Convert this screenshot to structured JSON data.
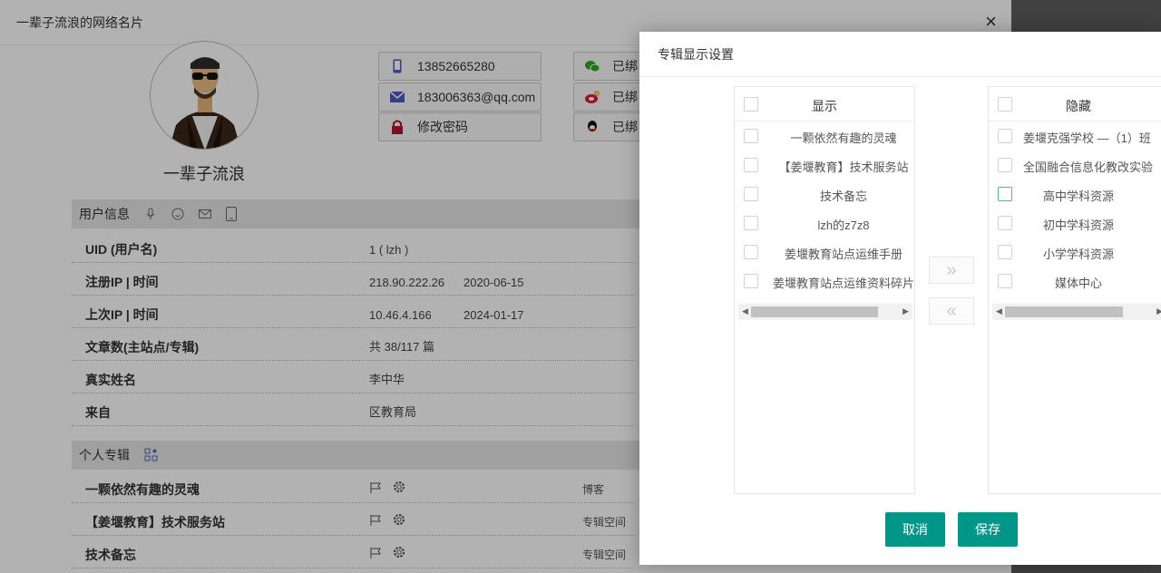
{
  "card": {
    "title": "一辈子流浪的网络名片",
    "close": "×",
    "nickname": "一辈子流浪",
    "contacts": {
      "phone": "13852665280",
      "email": "183006363@qq.com",
      "password": "修改密码",
      "wechat": "已绑",
      "weibo": "已绑",
      "qq": "已绑"
    },
    "user_section": {
      "title": "用户信息"
    },
    "info": [
      {
        "key": "UID (用户名)",
        "value": "1 ( lzh )",
        "value2": ""
      },
      {
        "key": "注册IP | 时间",
        "value": "218.90.222.26",
        "value2": "2020-06-15"
      },
      {
        "key": "上次IP | 时间",
        "value": "10.46.4.166",
        "value2": "2024-01-17"
      },
      {
        "key": "文章数(主站点/专辑)",
        "value": "共 38/117 篇",
        "value2": ""
      },
      {
        "key": "真实姓名",
        "value": "李中华",
        "value2": ""
      },
      {
        "key": "来自",
        "value": "区教育局",
        "value2": ""
      }
    ],
    "col_section": {
      "title": "个人专辑"
    },
    "collections": [
      {
        "name": "一颗依然有趣的灵魂",
        "type": "博客"
      },
      {
        "name": "【姜堰教育】技术服务站",
        "type": "专辑空间"
      },
      {
        "name": "技术备忘",
        "type": "专辑空间"
      }
    ]
  },
  "modal": {
    "title": "专辑显示设置",
    "left": {
      "title": "显示",
      "items": [
        "一颗依然有趣的灵魂",
        "【姜堰教育】技术服务站",
        "技术备忘",
        "lzh的z7z8",
        "姜堰教育站点运维手册",
        "姜堰教育站点运维资料碎片"
      ]
    },
    "right": {
      "title": "隐藏",
      "items": [
        "姜堰克强学校 —（1）班",
        "全国融合信息化教改实验",
        "高中学科资源",
        "初中学科资源",
        "小学学科资源",
        "媒体中心"
      ]
    },
    "move_right": "»",
    "move_left": "«",
    "cancel": "取消",
    "save": "保存"
  },
  "colors": {
    "primary": "#009688",
    "checkbox_hover": "#5fb878"
  }
}
